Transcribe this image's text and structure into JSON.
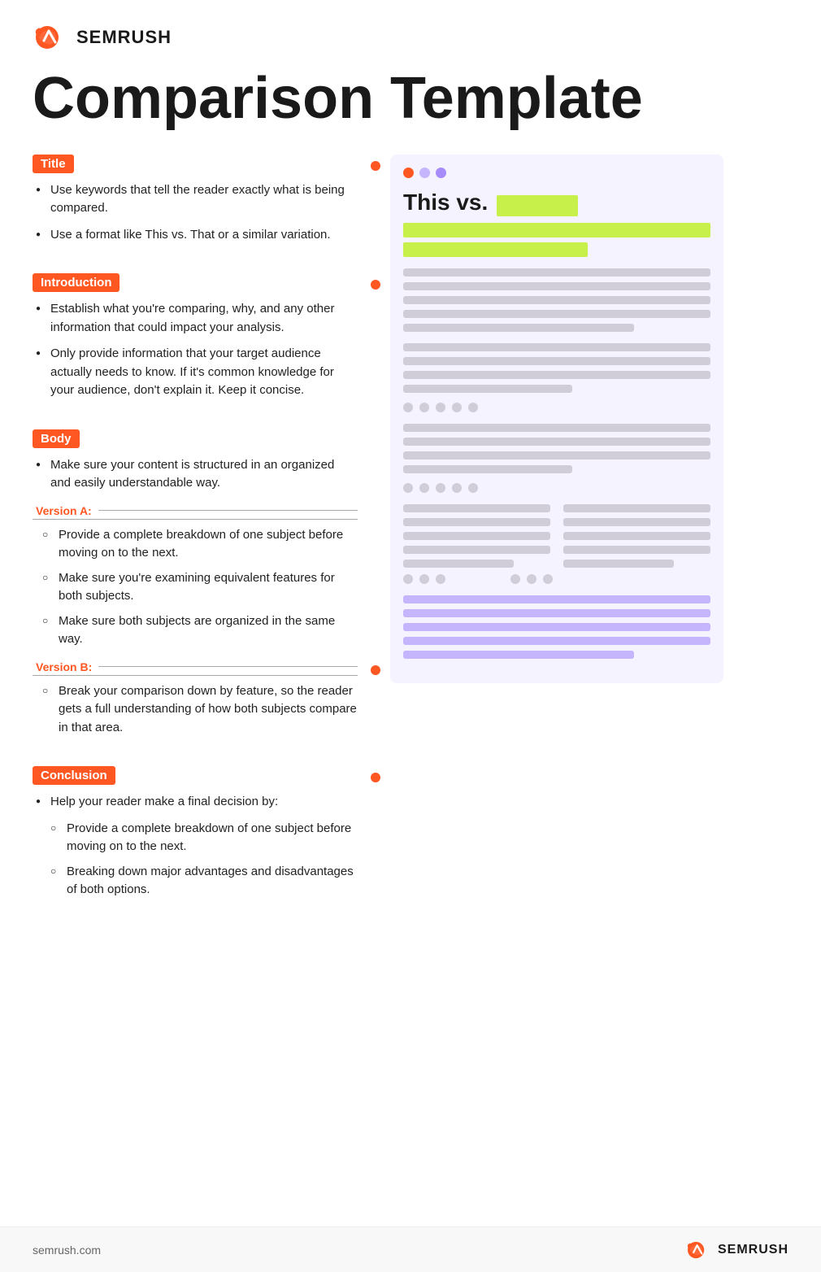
{
  "brand": {
    "name": "SEMRUSH",
    "url": "semrush.com"
  },
  "page": {
    "title": "Comparison Template"
  },
  "sections": {
    "title": {
      "label": "Title",
      "bullets": [
        "Use keywords that tell the reader exactly what is being compared.",
        "Use a format like This vs. That or a similar variation."
      ]
    },
    "introduction": {
      "label": "Introduction",
      "bullets": [
        "Establish what you're comparing, why, and any other information that could impact your analysis.",
        "Only provide information that your target audience actually needs to know. If it's common knowledge for your audience, don't explain it. Keep it concise."
      ]
    },
    "body": {
      "label": "Body",
      "intro_bullet": "Make sure your content is structured in an organized and easily understandable way.",
      "version_a": {
        "label": "Version A:",
        "items": [
          "Provide a complete breakdown of one subject before moving on to the next.",
          "Make sure you're examining equivalent features for both subjects.",
          "Make sure both subjects are organized in the same way."
        ]
      },
      "version_b": {
        "label": "Version B:",
        "items": [
          "Break your comparison down by feature, so the reader gets a full understanding of how both subjects compare in that area."
        ]
      }
    },
    "conclusion": {
      "label": "Conclusion",
      "intro_bullet": "Help your reader make a final decision by:",
      "items": [
        "Provide a complete breakdown of one subject before moving on to the next.",
        "Breaking down major advantages and disadvantages of both options."
      ]
    }
  },
  "mockup": {
    "title_text": "This vs.",
    "dots": [
      "orange",
      "lavender",
      "lavender2"
    ]
  },
  "footer": {
    "url": "semrush.com"
  }
}
